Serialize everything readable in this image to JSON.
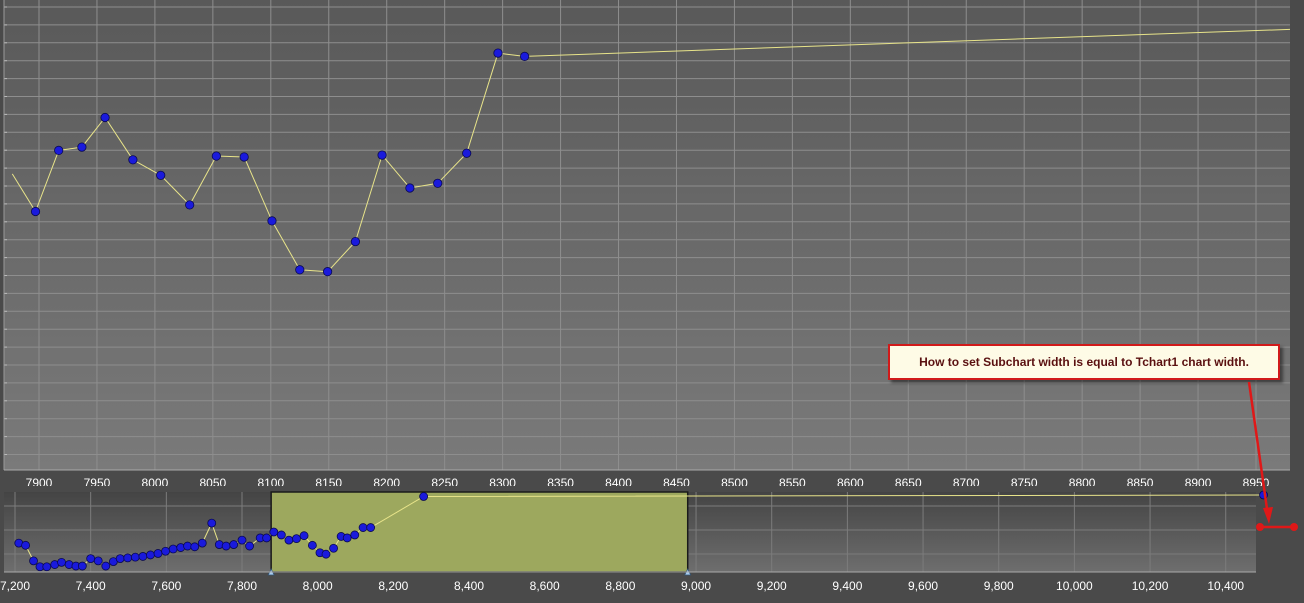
{
  "colors": {
    "background": "#4a4a4a",
    "plot_top": "#595959",
    "plot_bottom": "#7a7a7a",
    "grid": "#8e8e8e",
    "line": "#e8e48a",
    "point": "#1a1adc",
    "point_edge": "#0a0a50",
    "selection": "#9da85e",
    "annotation_border": "#d11a1a",
    "arrow": "#e01818"
  },
  "annotation": {
    "text": "How to set Subchart width is equal to Tchart1 chart width."
  },
  "chart_data": [
    {
      "name": "main_chart",
      "type": "line",
      "xlim": [
        7880,
        8960
      ],
      "ylim": [
        0,
        100
      ],
      "x_ticks": [
        7900,
        7950,
        8000,
        8050,
        8100,
        8150,
        8200,
        8250,
        8300,
        8350,
        8400,
        8450,
        8500,
        8550,
        8600,
        8650,
        8700,
        8750,
        8800,
        8850,
        8900,
        8950
      ],
      "x_tick_labels": [
        "7900",
        "7950",
        "8000",
        "8050",
        "8100",
        "8150",
        "8200",
        "8250",
        "8300",
        "8350",
        "8400",
        "8450",
        "8500",
        "8550",
        "8600",
        "8650",
        "8700",
        "8750",
        "8800",
        "8850",
        "8900",
        "8950"
      ],
      "y_gridline_count": 26,
      "grid": true,
      "line_from": [
        7877,
        63
      ],
      "points": [
        [
          7897,
          55
        ],
        [
          7917,
          68
        ],
        [
          7937,
          68.7
        ],
        [
          7957,
          75
        ],
        [
          7981,
          66
        ],
        [
          8005,
          62.7
        ],
        [
          8030,
          56.4
        ],
        [
          8053,
          66.8
        ],
        [
          8077,
          66.6
        ],
        [
          8101,
          53
        ],
        [
          8125,
          42.6
        ],
        [
          8149,
          42.2
        ],
        [
          8173,
          48.6
        ],
        [
          8196,
          67
        ],
        [
          8220,
          60
        ],
        [
          8244,
          61
        ],
        [
          8269,
          67.4
        ],
        [
          8296,
          88.7
        ],
        [
          8319,
          88
        ]
      ],
      "line_to": [
        10500,
        107
      ]
    },
    {
      "name": "sub_chart",
      "type": "line",
      "xlim": [
        7200,
        10600
      ],
      "ylim": [
        0,
        100
      ],
      "x_ticks": [
        7200,
        7400,
        7600,
        7800,
        8000,
        8200,
        8400,
        8600,
        8800,
        9000,
        9200,
        9400,
        9600,
        9800,
        10000,
        10200,
        10400
      ],
      "x_tick_labels": [
        "7,200",
        "7,400",
        "7,600",
        "7,800",
        "8,000",
        "8,200",
        "8,400",
        "8,600",
        "8,800",
        "9,000",
        "9,200",
        "9,400",
        "9,600",
        "9,800",
        "10,000",
        "10,200",
        "10,400"
      ],
      "y_gridline_count": 3,
      "grid": true,
      "selection_range": [
        7877,
        8978
      ],
      "points": [
        [
          7210,
          35
        ],
        [
          7228,
          32
        ],
        [
          7249,
          11
        ],
        [
          7266,
          3
        ],
        [
          7284,
          3
        ],
        [
          7305,
          6
        ],
        [
          7323,
          9
        ],
        [
          7343,
          6
        ],
        [
          7361,
          4
        ],
        [
          7378,
          4
        ],
        [
          7400,
          14
        ],
        [
          7420,
          11
        ],
        [
          7440,
          4
        ],
        [
          7460,
          10
        ],
        [
          7478,
          14
        ],
        [
          7498,
          15
        ],
        [
          7518,
          16
        ],
        [
          7538,
          17
        ],
        [
          7558,
          19
        ],
        [
          7578,
          21
        ],
        [
          7598,
          24
        ],
        [
          7618,
          27
        ],
        [
          7638,
          29
        ],
        [
          7656,
          31
        ],
        [
          7675,
          30
        ],
        [
          7695,
          35
        ],
        [
          7720,
          62
        ],
        [
          7740,
          33
        ],
        [
          7758,
          31
        ],
        [
          7778,
          33
        ],
        [
          7800,
          39
        ],
        [
          7820,
          31
        ],
        [
          7848,
          42
        ],
        [
          7865,
          42
        ],
        [
          7884,
          50
        ],
        [
          7904,
          46
        ],
        [
          7924,
          39
        ],
        [
          7944,
          41
        ],
        [
          7964,
          45
        ],
        [
          7986,
          32
        ],
        [
          8006,
          22
        ],
        [
          8022,
          20
        ],
        [
          8042,
          28
        ],
        [
          8062,
          44
        ],
        [
          8078,
          42
        ],
        [
          8098,
          46
        ],
        [
          8120,
          56
        ],
        [
          8140,
          56
        ],
        [
          8280,
          98
        ]
      ],
      "end_point": [
        10500,
        100
      ]
    }
  ]
}
